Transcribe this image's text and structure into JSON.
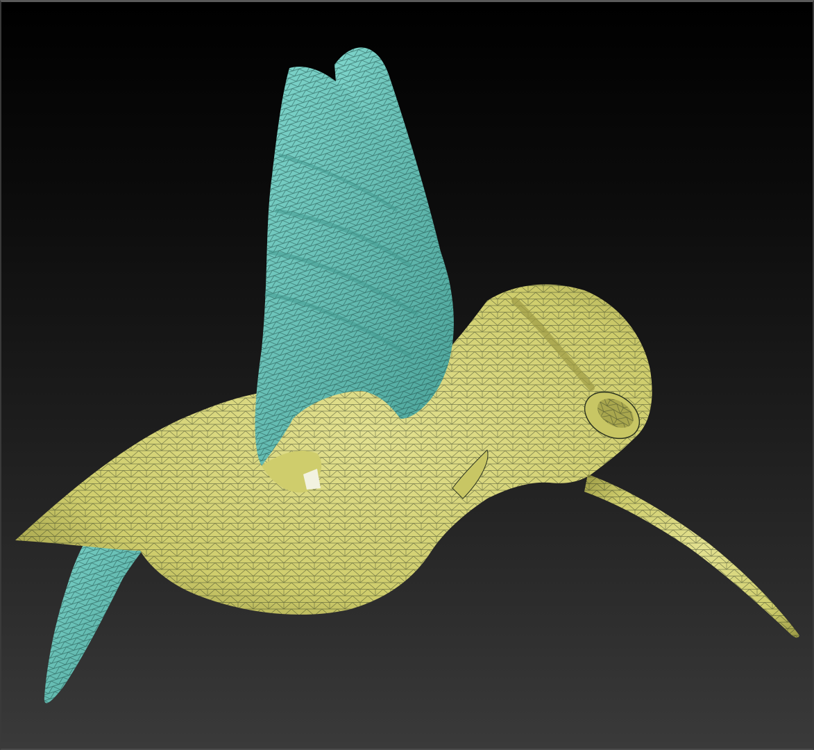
{
  "viewport": {
    "background_top": "#000000",
    "background_bottom": "#3a3a3a",
    "frame_color": "#5a5a5a"
  },
  "model": {
    "subject": "hummingbird",
    "body_color": "#d9d77a",
    "body_shade": "#b8b65a",
    "wing_color": "#6fc9bf",
    "wing_shade": "#4fa89e",
    "wireframe_color": "#1e2a1e",
    "display_mode": "polyframe"
  }
}
